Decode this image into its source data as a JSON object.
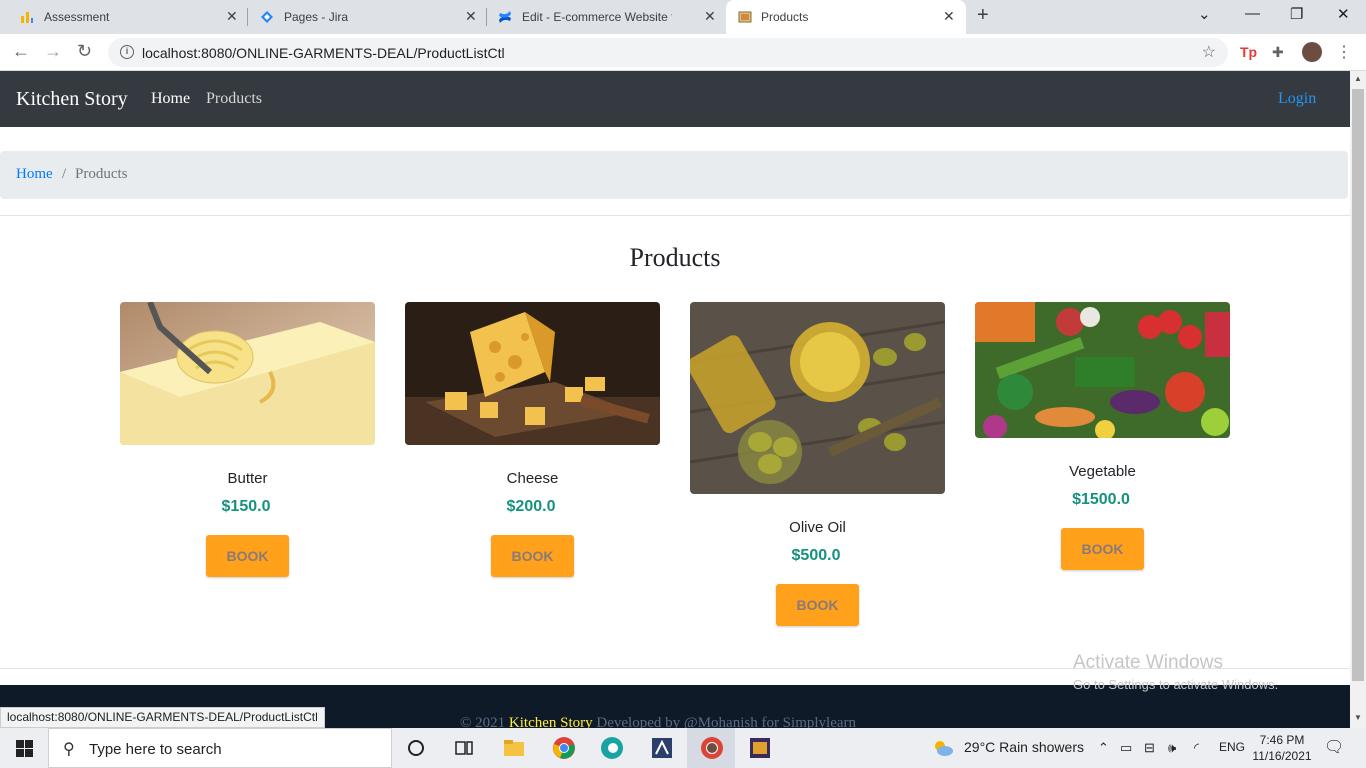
{
  "browser": {
    "tabs": [
      {
        "label": "Assessment",
        "icon": "chart-bars-icon"
      },
      {
        "label": "Pages - Jira",
        "icon": "jira-icon"
      },
      {
        "label": "Edit - E-commerce Website for Ki",
        "icon": "confluence-icon"
      },
      {
        "label": "Products",
        "icon": "page-favicon"
      }
    ],
    "url": "localhost:8080/ONLINE-GARMENTS-DEAL/ProductListCtl",
    "status_url": "localhost:8080/ONLINE-GARMENTS-DEAL/ProductListCtl"
  },
  "navbar": {
    "brand": "Kitchen Story",
    "links": [
      "Home",
      "Products"
    ],
    "login": "Login"
  },
  "breadcrumb": {
    "home": "Home",
    "separator": "/",
    "current": "Products"
  },
  "section_title": "Products",
  "products": [
    {
      "name": "Butter",
      "price": "$150.0",
      "button": "BOOK",
      "image": "butter"
    },
    {
      "name": "Cheese",
      "price": "$200.0",
      "button": "BOOK",
      "image": "cheese"
    },
    {
      "name": "Olive Oil",
      "price": "$500.0",
      "button": "BOOK",
      "image": "olive-oil"
    },
    {
      "name": "Vegetable",
      "price": "$1500.0",
      "button": "BOOK",
      "image": "vegetables"
    }
  ],
  "footer": {
    "prefix": "© 2021 ",
    "brand": "Kitchen Story",
    "suffix": " Developed by @Mohanish for Simplylearn"
  },
  "watermark": {
    "line1": "Activate Windows",
    "line2": "Go to Settings to activate Windows."
  },
  "taskbar": {
    "search_placeholder": "Type here to search",
    "weather": "29°C  Rain showers",
    "language": "ENG",
    "time": "7:46 PM",
    "date": "11/16/2021"
  },
  "colors": {
    "navbar_bg": "#343a40",
    "breadcrumb_bg": "#e9ecef",
    "link_blue": "#007bff",
    "price_green": "#17917f",
    "button_orange": "#ffa11b",
    "footer_bg": "#0f1a29",
    "footer_brand": "#ffeb3b"
  }
}
